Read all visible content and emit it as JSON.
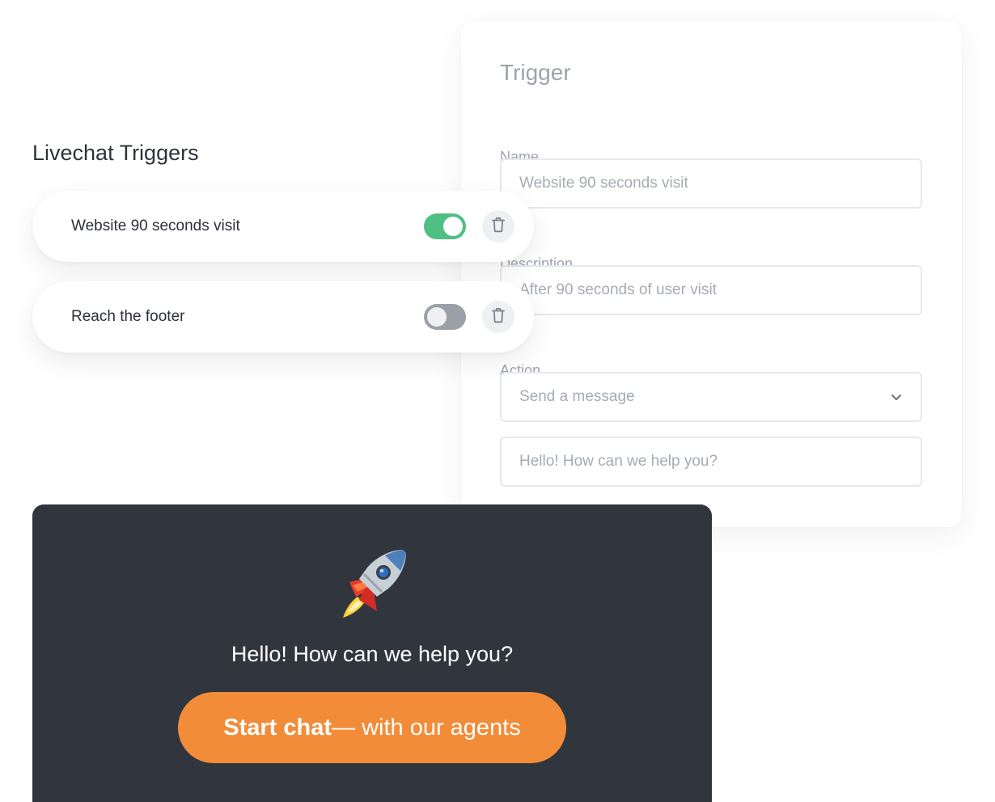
{
  "trigger_form": {
    "title": "Trigger",
    "name_label": "Name",
    "name_value": "Website 90 seconds visit",
    "description_label": "Description",
    "description_value": "After 90 seconds of user visit",
    "action_label": "Action",
    "action_selected": "Send a message",
    "message_value": "Hello! How can we help you?"
  },
  "triggers_list": {
    "title": "Livechat Triggers",
    "items": [
      {
        "label": "Website 90 seconds visit",
        "enabled": true
      },
      {
        "label": "Reach the footer",
        "enabled": false
      }
    ]
  },
  "chat_widget": {
    "icon": "rocket-icon",
    "greeting": "Hello! How can we help you?",
    "button_bold": "Start chat",
    "button_rest": " — with our agents"
  },
  "colors": {
    "toggle_on": "#4fbf83",
    "toggle_off": "#9ba0a8",
    "chat_background": "#31353d",
    "button_accent": "#f28c38"
  }
}
